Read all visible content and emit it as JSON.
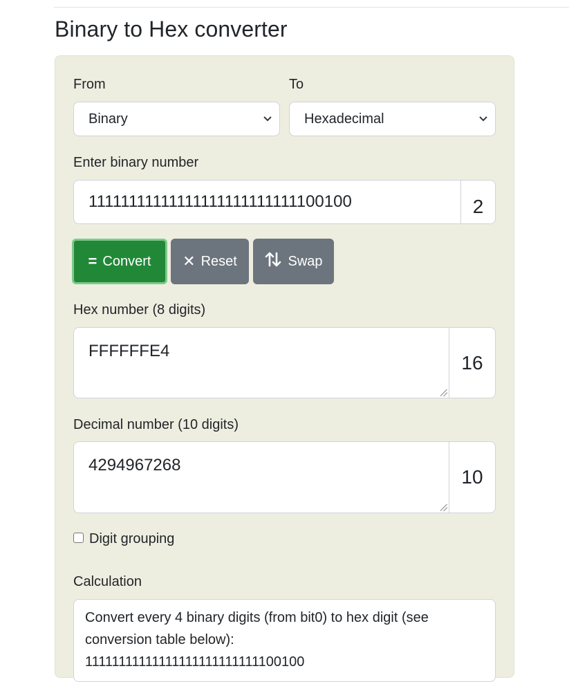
{
  "page": {
    "title": "Binary to Hex converter"
  },
  "from": {
    "label": "From",
    "selected": "Binary"
  },
  "to": {
    "label": "To",
    "selected": "Hexadecimal"
  },
  "input": {
    "label": "Enter binary number",
    "value": "11111111111111111111111111100100",
    "base": "2"
  },
  "buttons": {
    "convert": "Convert",
    "reset": "Reset",
    "swap": "Swap"
  },
  "hex_output": {
    "label": "Hex number (8 digits)",
    "value": "FFFFFFE4",
    "base": "16"
  },
  "decimal_output": {
    "label": "Decimal number (10 digits)",
    "value": "4294967268",
    "base": "10"
  },
  "grouping": {
    "label": "Digit grouping",
    "checked": false
  },
  "calculation": {
    "label": "Calculation",
    "text": "Convert every 4 binary digits (from bit0) to hex digit (see conversion table below):",
    "binary": "11111111111111111111111111100100"
  },
  "colors": {
    "panel": "#eeeee0",
    "convert": "#218838",
    "secondary": "#6c757d"
  },
  "icons": {
    "convert": "equals-icon",
    "reset": "close-icon",
    "swap": "swap-arrows-icon",
    "dropdown": "chevron-down-icon"
  }
}
